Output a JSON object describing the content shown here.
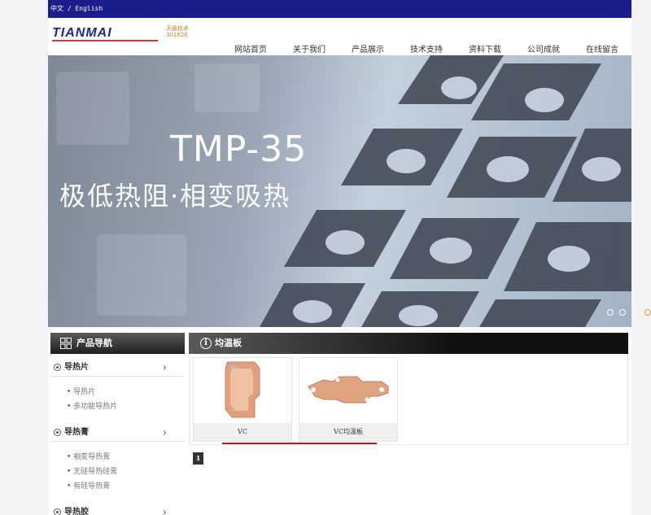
{
  "topbar": {
    "lang": "中文 / English"
  },
  "logo": {
    "text": "TIANMAI",
    "badge_line1": "天脉技术",
    "badge_line2": "301626"
  },
  "nav": [
    "网站首页",
    "关于我们",
    "产品展示",
    "技术支持",
    "资料下载",
    "公司成就",
    "在线留言"
  ],
  "banner": {
    "title": "TMP-35",
    "subtitle": "极低热阻·相变吸热"
  },
  "sidebar": {
    "title": "产品导航",
    "categories": [
      {
        "label": "导热片",
        "items": [
          "导热片",
          "多功能导热片"
        ]
      },
      {
        "label": "导热膏",
        "items": [
          "相变导热膏",
          "无硅导热硅膏",
          "有硅导热膏"
        ]
      },
      {
        "label": "导热胶",
        "items": []
      }
    ]
  },
  "main": {
    "title": "均温板",
    "products": [
      {
        "label": "VC"
      },
      {
        "label": "VC均温板"
      }
    ],
    "page": "1"
  },
  "colors": {
    "topbar": "#1b1d8c",
    "accent": "#c8101a"
  }
}
